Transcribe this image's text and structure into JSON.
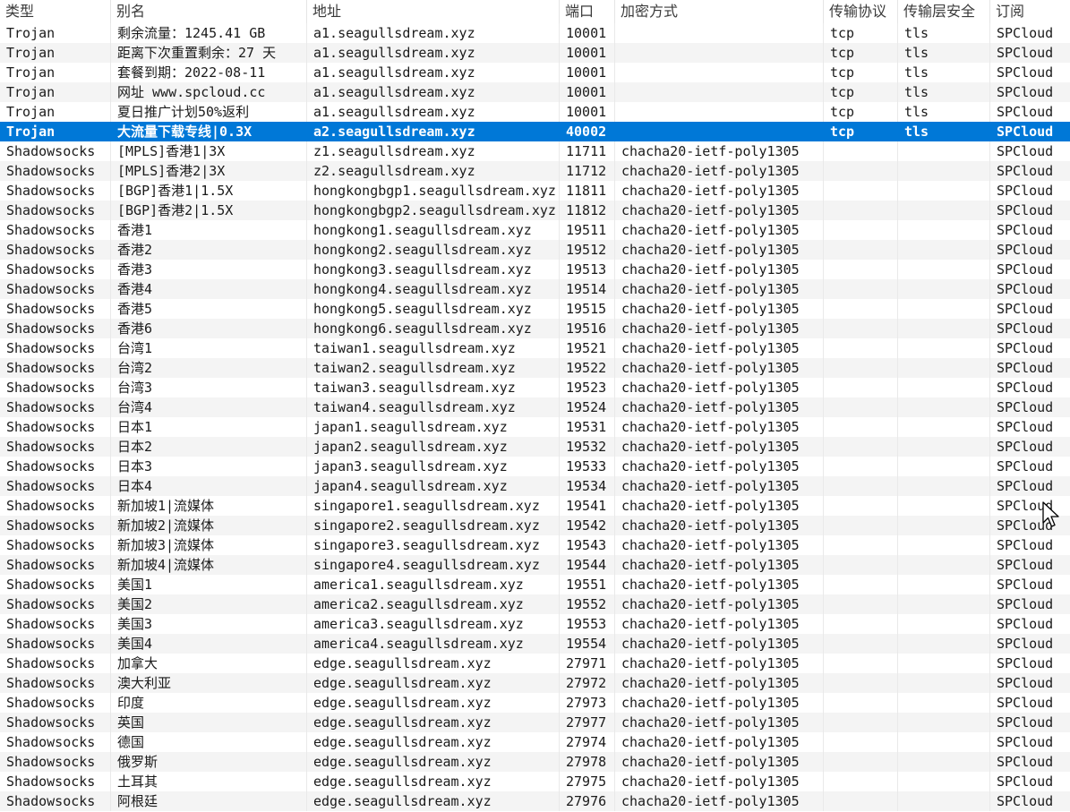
{
  "columns": [
    "类型",
    "别名",
    "地址",
    "端口",
    "加密方式",
    "传输协议",
    "传输层安全",
    "订阅"
  ],
  "colors": {
    "selection": "#0078d7",
    "selection_text": "#ffffff",
    "alt_row": "#f4f4f4"
  },
  "selected_index": 5,
  "rows": [
    [
      "Trojan",
      "剩余流量：1245.41 GB",
      "a1.seagullsdream.xyz",
      "10001",
      "",
      "tcp",
      "tls",
      "SPCloud"
    ],
    [
      "Trojan",
      "距离下次重置剩余：27 天",
      "a1.seagullsdream.xyz",
      "10001",
      "",
      "tcp",
      "tls",
      "SPCloud"
    ],
    [
      "Trojan",
      "套餐到期：2022-08-11",
      "a1.seagullsdream.xyz",
      "10001",
      "",
      "tcp",
      "tls",
      "SPCloud"
    ],
    [
      "Trojan",
      "网址 www.spcloud.cc",
      "a1.seagullsdream.xyz",
      "10001",
      "",
      "tcp",
      "tls",
      "SPCloud"
    ],
    [
      "Trojan",
      "夏日推广计划50%返利",
      "a1.seagullsdream.xyz",
      "10001",
      "",
      "tcp",
      "tls",
      "SPCloud"
    ],
    [
      "Trojan",
      "大流量下载专线|0.3X",
      "a2.seagullsdream.xyz",
      "40002",
      "",
      "tcp",
      "tls",
      "SPCloud"
    ],
    [
      "Shadowsocks",
      "[MPLS]香港1|3X",
      "z1.seagullsdream.xyz",
      "11711",
      "chacha20-ietf-poly1305",
      "",
      "",
      "SPCloud"
    ],
    [
      "Shadowsocks",
      "[MPLS]香港2|3X",
      "z2.seagullsdream.xyz",
      "11712",
      "chacha20-ietf-poly1305",
      "",
      "",
      "SPCloud"
    ],
    [
      "Shadowsocks",
      "[BGP]香港1|1.5X",
      "hongkongbgp1.seagullsdream.xyz",
      "11811",
      "chacha20-ietf-poly1305",
      "",
      "",
      "SPCloud"
    ],
    [
      "Shadowsocks",
      "[BGP]香港2|1.5X",
      "hongkongbgp2.seagullsdream.xyz",
      "11812",
      "chacha20-ietf-poly1305",
      "",
      "",
      "SPCloud"
    ],
    [
      "Shadowsocks",
      "香港1",
      "hongkong1.seagullsdream.xyz",
      "19511",
      "chacha20-ietf-poly1305",
      "",
      "",
      "SPCloud"
    ],
    [
      "Shadowsocks",
      "香港2",
      "hongkong2.seagullsdream.xyz",
      "19512",
      "chacha20-ietf-poly1305",
      "",
      "",
      "SPCloud"
    ],
    [
      "Shadowsocks",
      "香港3",
      "hongkong3.seagullsdream.xyz",
      "19513",
      "chacha20-ietf-poly1305",
      "",
      "",
      "SPCloud"
    ],
    [
      "Shadowsocks",
      "香港4",
      "hongkong4.seagullsdream.xyz",
      "19514",
      "chacha20-ietf-poly1305",
      "",
      "",
      "SPCloud"
    ],
    [
      "Shadowsocks",
      "香港5",
      "hongkong5.seagullsdream.xyz",
      "19515",
      "chacha20-ietf-poly1305",
      "",
      "",
      "SPCloud"
    ],
    [
      "Shadowsocks",
      "香港6",
      "hongkong6.seagullsdream.xyz",
      "19516",
      "chacha20-ietf-poly1305",
      "",
      "",
      "SPCloud"
    ],
    [
      "Shadowsocks",
      "台湾1",
      "taiwan1.seagullsdream.xyz",
      "19521",
      "chacha20-ietf-poly1305",
      "",
      "",
      "SPCloud"
    ],
    [
      "Shadowsocks",
      "台湾2",
      "taiwan2.seagullsdream.xyz",
      "19522",
      "chacha20-ietf-poly1305",
      "",
      "",
      "SPCloud"
    ],
    [
      "Shadowsocks",
      "台湾3",
      "taiwan3.seagullsdream.xyz",
      "19523",
      "chacha20-ietf-poly1305",
      "",
      "",
      "SPCloud"
    ],
    [
      "Shadowsocks",
      "台湾4",
      "taiwan4.seagullsdream.xyz",
      "19524",
      "chacha20-ietf-poly1305",
      "",
      "",
      "SPCloud"
    ],
    [
      "Shadowsocks",
      "日本1",
      "japan1.seagullsdream.xyz",
      "19531",
      "chacha20-ietf-poly1305",
      "",
      "",
      "SPCloud"
    ],
    [
      "Shadowsocks",
      "日本2",
      "japan2.seagullsdream.xyz",
      "19532",
      "chacha20-ietf-poly1305",
      "",
      "",
      "SPCloud"
    ],
    [
      "Shadowsocks",
      "日本3",
      "japan3.seagullsdream.xyz",
      "19533",
      "chacha20-ietf-poly1305",
      "",
      "",
      "SPCloud"
    ],
    [
      "Shadowsocks",
      "日本4",
      "japan4.seagullsdream.xyz",
      "19534",
      "chacha20-ietf-poly1305",
      "",
      "",
      "SPCloud"
    ],
    [
      "Shadowsocks",
      "新加坡1|流媒体",
      "singapore1.seagullsdream.xyz",
      "19541",
      "chacha20-ietf-poly1305",
      "",
      "",
      "SPCloud"
    ],
    [
      "Shadowsocks",
      "新加坡2|流媒体",
      "singapore2.seagullsdream.xyz",
      "19542",
      "chacha20-ietf-poly1305",
      "",
      "",
      "SPCloud"
    ],
    [
      "Shadowsocks",
      "新加坡3|流媒体",
      "singapore3.seagullsdream.xyz",
      "19543",
      "chacha20-ietf-poly1305",
      "",
      "",
      "SPCloud"
    ],
    [
      "Shadowsocks",
      "新加坡4|流媒体",
      "singapore4.seagullsdream.xyz",
      "19544",
      "chacha20-ietf-poly1305",
      "",
      "",
      "SPCloud"
    ],
    [
      "Shadowsocks",
      "美国1",
      "america1.seagullsdream.xyz",
      "19551",
      "chacha20-ietf-poly1305",
      "",
      "",
      "SPCloud"
    ],
    [
      "Shadowsocks",
      "美国2",
      "america2.seagullsdream.xyz",
      "19552",
      "chacha20-ietf-poly1305",
      "",
      "",
      "SPCloud"
    ],
    [
      "Shadowsocks",
      "美国3",
      "america3.seagullsdream.xyz",
      "19553",
      "chacha20-ietf-poly1305",
      "",
      "",
      "SPCloud"
    ],
    [
      "Shadowsocks",
      "美国4",
      "america4.seagullsdream.xyz",
      "19554",
      "chacha20-ietf-poly1305",
      "",
      "",
      "SPCloud"
    ],
    [
      "Shadowsocks",
      "加拿大",
      "edge.seagullsdream.xyz",
      "27971",
      "chacha20-ietf-poly1305",
      "",
      "",
      "SPCloud"
    ],
    [
      "Shadowsocks",
      "澳大利亚",
      "edge.seagullsdream.xyz",
      "27972",
      "chacha20-ietf-poly1305",
      "",
      "",
      "SPCloud"
    ],
    [
      "Shadowsocks",
      "印度",
      "edge.seagullsdream.xyz",
      "27973",
      "chacha20-ietf-poly1305",
      "",
      "",
      "SPCloud"
    ],
    [
      "Shadowsocks",
      "英国",
      "edge.seagullsdream.xyz",
      "27977",
      "chacha20-ietf-poly1305",
      "",
      "",
      "SPCloud"
    ],
    [
      "Shadowsocks",
      "德国",
      "edge.seagullsdream.xyz",
      "27974",
      "chacha20-ietf-poly1305",
      "",
      "",
      "SPCloud"
    ],
    [
      "Shadowsocks",
      "俄罗斯",
      "edge.seagullsdream.xyz",
      "27978",
      "chacha20-ietf-poly1305",
      "",
      "",
      "SPCloud"
    ],
    [
      "Shadowsocks",
      "土耳其",
      "edge.seagullsdream.xyz",
      "27975",
      "chacha20-ietf-poly1305",
      "",
      "",
      "SPCloud"
    ],
    [
      "Shadowsocks",
      "阿根廷",
      "edge.seagullsdream.xyz",
      "27976",
      "chacha20-ietf-poly1305",
      "",
      "",
      "SPCloud"
    ]
  ]
}
